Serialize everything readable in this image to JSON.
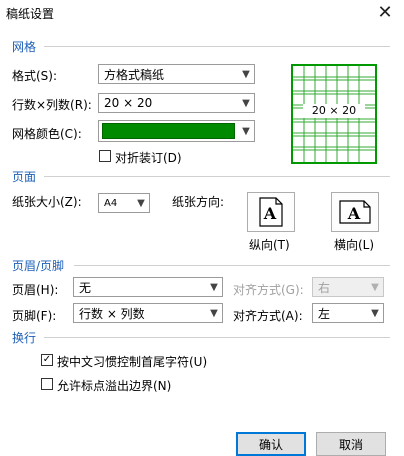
{
  "window": {
    "title": "稿纸设置",
    "close_glyph": "✕"
  },
  "sections": {
    "grid": "网格",
    "page": "页面",
    "header_footer": "页眉/页脚",
    "line_break": "换行"
  },
  "grid": {
    "format_label": "格式(S):",
    "format_value": "方格式稿纸",
    "rows_cols_label": "行数×列数(R):",
    "rows_cols_value": "20 × 20",
    "color_label": "网格颜色(C):",
    "color_value": "#008a00",
    "fold_label": "对折装订(D)",
    "fold_checked": false,
    "preview_text": "20 × 20"
  },
  "page": {
    "paper_size_label": "纸张大小(Z):",
    "paper_size_value": "A4",
    "orientation_label": "纸张方向:",
    "portrait_label": "纵向(T)",
    "landscape_label": "横向(L)",
    "icon_letter": "A"
  },
  "header_footer": {
    "header_label": "页眉(H):",
    "header_value": "无",
    "header_align_label": "对齐方式(G):",
    "header_align_value": "右",
    "footer_label": "页脚(F):",
    "footer_value": "行数 × 列数",
    "footer_align_label": "对齐方式(A):",
    "footer_align_value": "左"
  },
  "line_break": {
    "option1_label": "按中文习惯控制首尾字符(U)",
    "option1_checked": true,
    "option2_label": "允许标点溢出边界(N)",
    "option2_checked": false
  },
  "buttons": {
    "ok": "确认",
    "cancel": "取消"
  },
  "check_glyph": "✓"
}
